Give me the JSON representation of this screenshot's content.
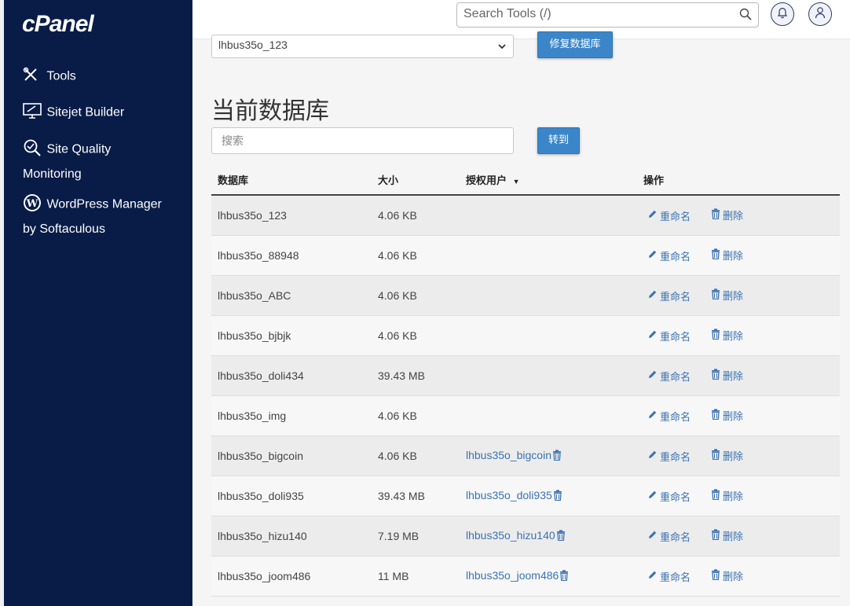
{
  "sidebar": {
    "logo": "cPanel",
    "items": [
      {
        "icon": "tools-icon",
        "label": "Tools"
      },
      {
        "icon": "sitejet-icon",
        "label": "Sitejet Builder"
      },
      {
        "icon": "site-quality-icon",
        "label": "Site Quality",
        "label2": "Monitoring"
      },
      {
        "icon": "wordpress-icon",
        "label": "WordPress Manager",
        "label2": "by Softaculous"
      }
    ]
  },
  "header": {
    "search_placeholder": "Search Tools (/)",
    "icons": [
      "search-icon",
      "bell-icon",
      "user-icon"
    ]
  },
  "repair": {
    "selected": "lhbus35o_123",
    "button": "修复数据库"
  },
  "current": {
    "title": "当前数据库",
    "search_placeholder": "搜索",
    "go_button": "转到"
  },
  "table": {
    "headers": {
      "name": "数据库",
      "size": "大小",
      "users": "授权用户",
      "actions": "操作"
    },
    "rename_label": "重命名",
    "delete_label": "删除",
    "rows": [
      {
        "name": "lhbus35o_123",
        "size": "4.06 KB",
        "user": ""
      },
      {
        "name": "lhbus35o_88948",
        "size": "4.06 KB",
        "user": ""
      },
      {
        "name": "lhbus35o_ABC",
        "size": "4.06 KB",
        "user": ""
      },
      {
        "name": "lhbus35o_bjbjk",
        "size": "4.06 KB",
        "user": ""
      },
      {
        "name": "lhbus35o_doli434",
        "size": "39.43 MB",
        "user": ""
      },
      {
        "name": "lhbus35o_img",
        "size": "4.06 KB",
        "user": ""
      },
      {
        "name": "lhbus35o_bigcoin",
        "size": "4.06 KB",
        "user": "lhbus35o_bigcoin"
      },
      {
        "name": "lhbus35o_doli935",
        "size": "39.43 MB",
        "user": "lhbus35o_doli935"
      },
      {
        "name": "lhbus35o_hizu140",
        "size": "7.19 MB",
        "user": "lhbus35o_hizu140"
      },
      {
        "name": "lhbus35o_joom486",
        "size": "11 MB",
        "user": "lhbus35o_joom486"
      }
    ]
  },
  "colors": {
    "sidebar": "#081c47",
    "accent": "#3b86c9",
    "link": "#3a72b3"
  }
}
